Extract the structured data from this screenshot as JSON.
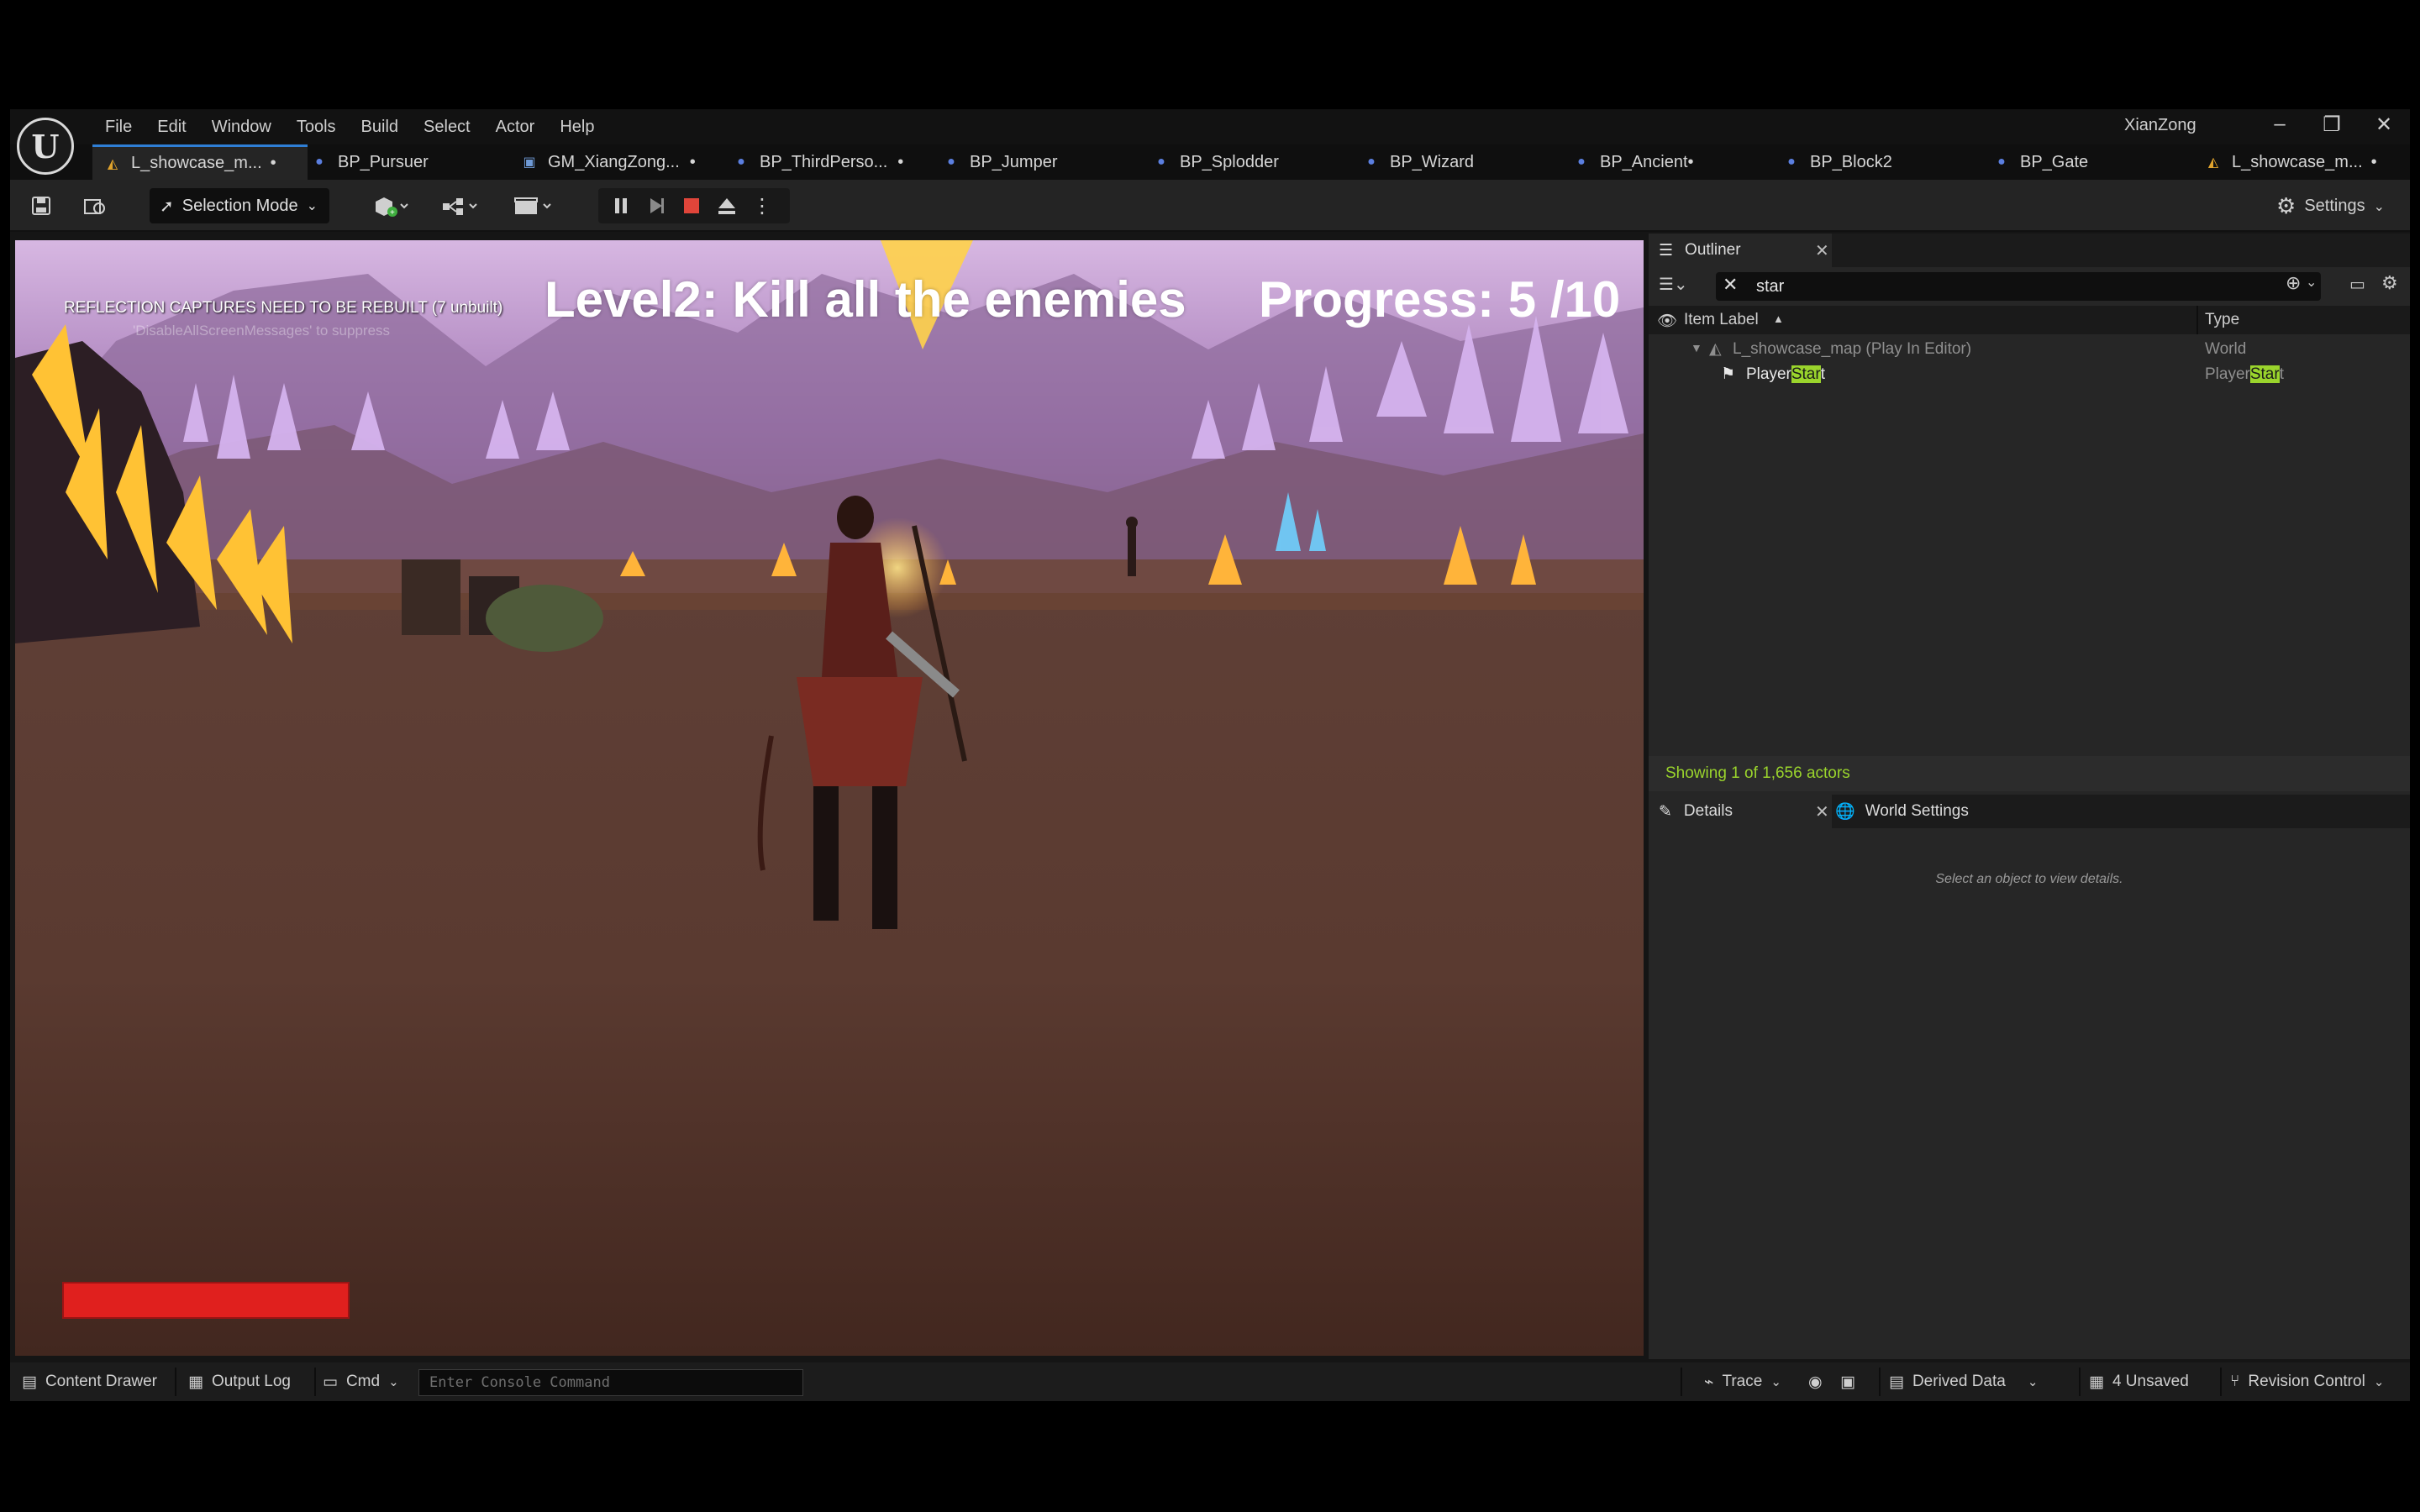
{
  "menu": [
    "File",
    "Edit",
    "Window",
    "Tools",
    "Build",
    "Select",
    "Actor",
    "Help"
  ],
  "user_name": "XianZong",
  "tabs": [
    {
      "label": "L_showcase_m...",
      "type": "level",
      "active": true
    },
    {
      "label": "BP_Pursuer",
      "type": "person"
    },
    {
      "label": "GM_XiangZong...",
      "type": "gm"
    },
    {
      "label": "BP_ThirdPerso...",
      "type": "person"
    },
    {
      "label": "BP_Jumper",
      "type": "person"
    },
    {
      "label": "BP_Splodder",
      "type": "person"
    },
    {
      "label": "BP_Wizard",
      "type": "person"
    },
    {
      "label": "BP_Ancient",
      "type": "person"
    },
    {
      "label": "BP_Block2",
      "type": "person"
    },
    {
      "label": "BP_Gate",
      "type": "person"
    },
    {
      "label": "L_showcase_m...",
      "type": "level"
    }
  ],
  "toolbar": {
    "selection_mode": "Selection Mode",
    "settings": "Settings"
  },
  "viewport": {
    "reflection_warning": "REFLECTION CAPTURES NEED TO BE REBUILT (7 unbuilt)",
    "reflection_sub": "'DisableAllScreenMessages' to suppress",
    "hud_title": "Level2: Kill all the enemies",
    "hud_progress": "Progress: 5  /10",
    "health_fraction": 1.0
  },
  "outliner": {
    "title": "Outliner",
    "search": "star",
    "col_label": "Item Label",
    "col_type": "Type",
    "rows": [
      {
        "label": "L_showcase_map (Play In Editor)",
        "type": "World"
      },
      {
        "label_pre": "Player",
        "label_hl": "Star",
        "label_post": "t",
        "type_pre": "Player",
        "type_hl": "Star",
        "type_post": "t"
      }
    ],
    "status": "Showing 1 of 1,656 actors"
  },
  "details": {
    "title": "Details",
    "world_settings": "World Settings",
    "empty": "Select an object to view details."
  },
  "statusbar": {
    "content_drawer": "Content Drawer",
    "output_log": "Output Log",
    "cmd": "Cmd",
    "console_placeholder": "Enter Console Command",
    "trace": "Trace",
    "derived_data": "Derived Data",
    "unsaved": "4 Unsaved",
    "revision": "Revision Control"
  },
  "colors": {
    "accent": "#2f7fd6",
    "highlight": "#9ad42c",
    "health": "#e0201e",
    "stop": "#e0453a"
  }
}
